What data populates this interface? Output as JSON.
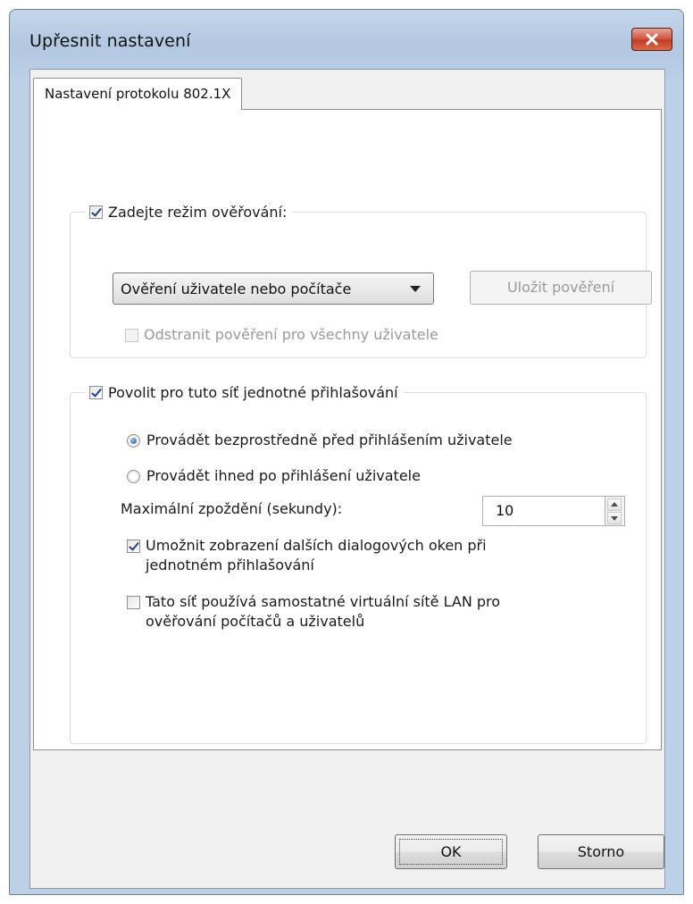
{
  "window": {
    "title": "Upřesnit nastavení"
  },
  "tabs": [
    {
      "label": "Nastavení protokolu 802.1X"
    }
  ],
  "auth_group": {
    "checkbox_label": "Zadejte režim ověřování:",
    "checked": true,
    "mode_dropdown": {
      "selected": "Ověření uživatele nebo počítače"
    },
    "save_credentials_button": "Uložit pověření",
    "delete_credentials_label": "Odstranit pověření pro všechny uživatele",
    "delete_credentials_checked": false
  },
  "sso_group": {
    "checkbox_label": "Povolit pro tuto síť jednotné přihlašování",
    "checked": true,
    "radio_before": "Provádět bezprostředně před přihlášením uživatele",
    "radio_after": "Provádět ihned po přihlášení uživatele",
    "selected_radio": "before",
    "max_delay_label": "Maximální zpoždění (sekundy):",
    "max_delay_value": "10",
    "allow_dialogs_line1": "Umožnit zobrazení dalších dialogových oken při",
    "allow_dialogs_line2": "jednotném přihlašování",
    "allow_dialogs_checked": true,
    "vlan_line1": "Tato síť používá samostatné virtuální sítě LAN pro",
    "vlan_line2": "ověřování počítačů a uživatelů",
    "vlan_checked": false
  },
  "footer": {
    "ok_label": "OK",
    "cancel_label": "Storno"
  },
  "icons": {
    "close": "close-icon",
    "dropdown": "chevron-down-icon",
    "spin_up": "arrow-up-icon",
    "spin_down": "arrow-down-icon"
  },
  "colors": {
    "title_bar": "#b9cde5",
    "close_button": "#c9422a",
    "selected_radio": "#1d4f9c"
  }
}
